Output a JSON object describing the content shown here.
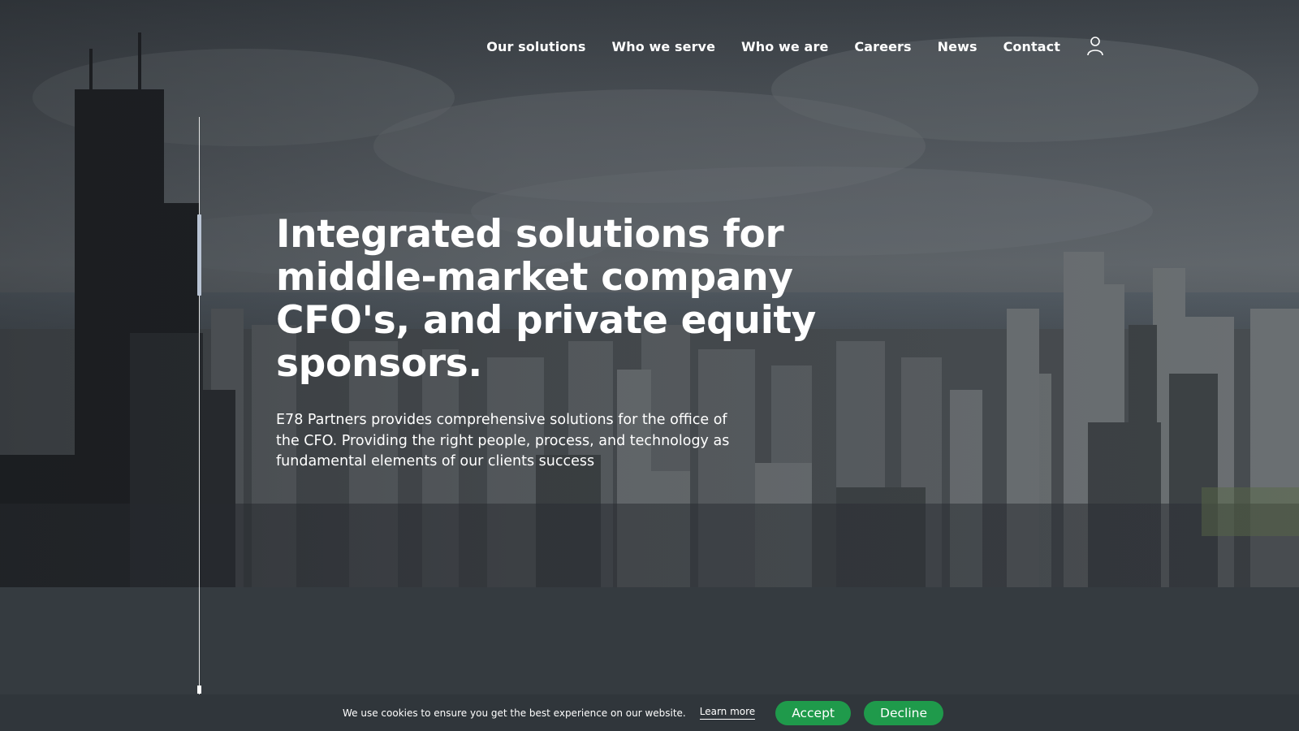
{
  "nav": {
    "items": [
      {
        "label": "Our solutions"
      },
      {
        "label": "Who we serve"
      },
      {
        "label": "Who we are"
      },
      {
        "label": "Careers"
      },
      {
        "label": "News"
      },
      {
        "label": "Contact"
      }
    ],
    "account_icon": "user-icon"
  },
  "hero": {
    "headline": "Integrated solutions for middle-market company CFO's, and private equity sponsors.",
    "lede": "E78 Partners provides comprehensive solutions for the office of the CFO. Providing the right people, process, and technology as fundamental elements of our clients success"
  },
  "cookie_banner": {
    "message": "We use cookies to ensure you get the best experience on our website.",
    "learn_more": "Learn more",
    "accept": "Accept",
    "decline": "Decline"
  },
  "colors": {
    "accent_green": "#1f9a4b",
    "footer_bg": "#353b40",
    "cookie_bg": "#30363b"
  }
}
